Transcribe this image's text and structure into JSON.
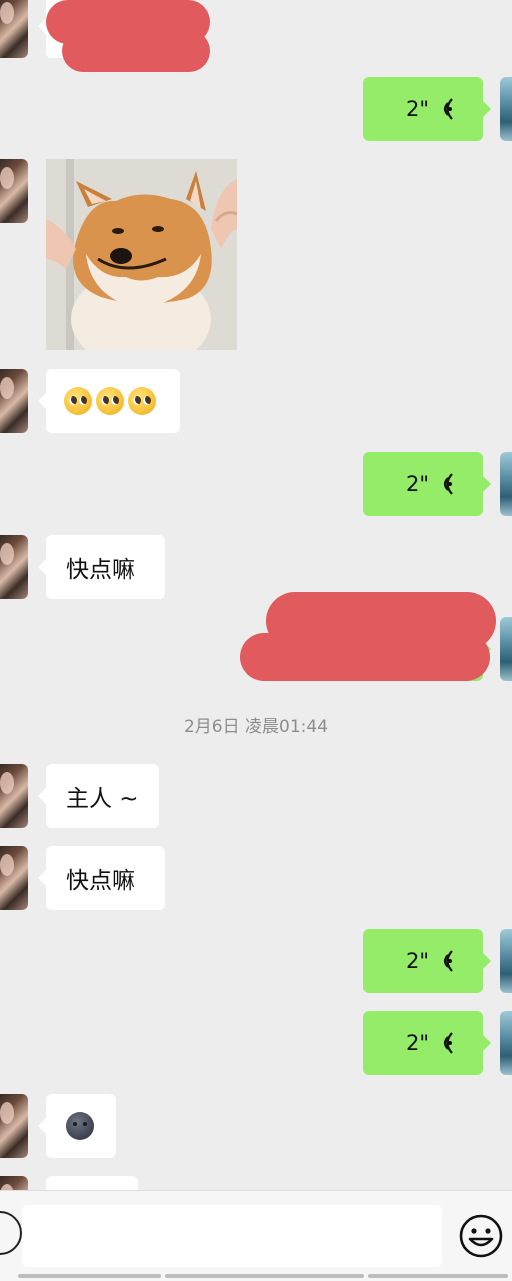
{
  "colors": {
    "background": "#ededed",
    "sent_bubble": "#95ec69",
    "received_bubble": "#ffffff",
    "timestamp_text": "#8d8d8d",
    "redaction": "#e05a5e"
  },
  "chat": {
    "timestamp": "2月6日 凌晨01:44",
    "messages": [
      {
        "side": "left",
        "type": "text",
        "text": "",
        "redacted": true
      },
      {
        "side": "right",
        "type": "voice",
        "duration": "2\""
      },
      {
        "side": "left",
        "type": "image",
        "icon": "shiba-dog-photo"
      },
      {
        "side": "left",
        "type": "emoji",
        "icon": "pleading-face-emoji",
        "count": 3
      },
      {
        "side": "right",
        "type": "voice",
        "duration": "2\""
      },
      {
        "side": "left",
        "type": "text",
        "text": "快点嘛"
      },
      {
        "side": "right",
        "type": "text",
        "text": "",
        "redacted": true
      },
      {
        "side": "left",
        "type": "text",
        "text": "主人 ~"
      },
      {
        "side": "left",
        "type": "text",
        "text": "快点嘛"
      },
      {
        "side": "right",
        "type": "voice",
        "duration": "2\""
      },
      {
        "side": "right",
        "type": "voice",
        "duration": "2\""
      },
      {
        "side": "left",
        "type": "emoji",
        "icon": "new-moon-face-emoji"
      },
      {
        "side": "left",
        "type": "text",
        "text": "",
        "partial": true
      }
    ]
  },
  "input_bar": {
    "text_value": "",
    "left_icon": "voice-mode-icon",
    "right_icon": "emoji-smile-icon"
  }
}
